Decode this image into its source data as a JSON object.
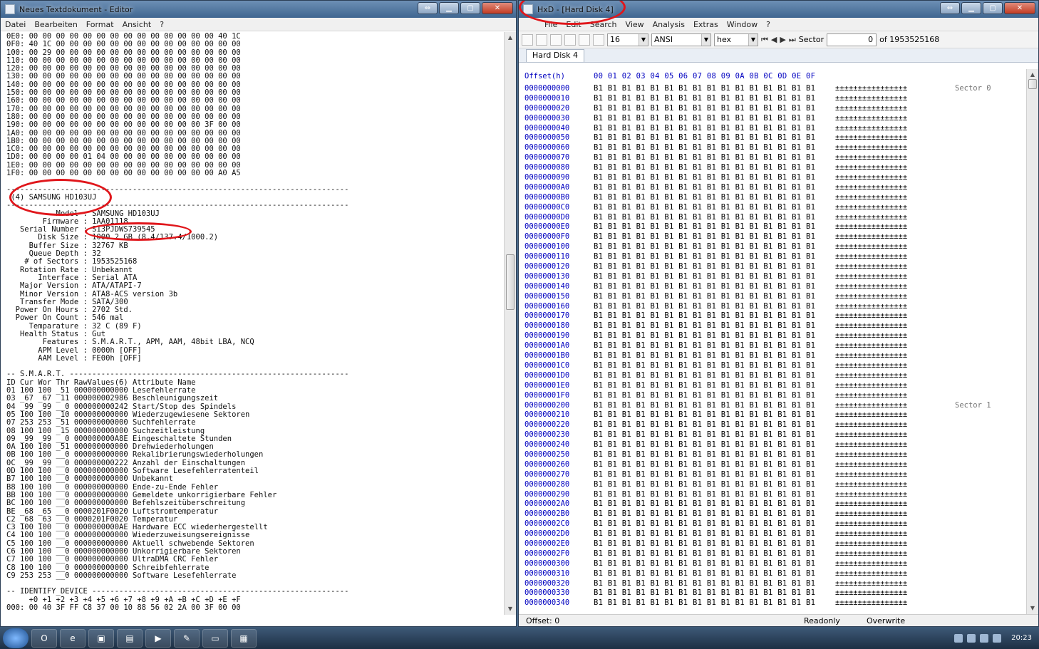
{
  "editor": {
    "title": "Neues Textdokument - Editor",
    "menu": [
      "Datei",
      "Bearbeiten",
      "Format",
      "Ansicht",
      "?"
    ],
    "lines": [
      "0E0: 00 00 00 00 00 00 00 00 00 00 00 00 00 00 40 1C",
      "0F0: 40 1C 00 00 00 00 00 00 00 00 00 00 00 00 00 00",
      "100: 00 29 00 00 00 00 00 00 00 00 00 00 00 00 00 00",
      "110: 00 00 00 00 00 00 00 00 00 00 00 00 00 00 00 00",
      "120: 00 00 00 00 00 00 00 00 00 00 00 00 00 00 00 00",
      "130: 00 00 00 00 00 00 00 00 00 00 00 00 00 00 00 00",
      "140: 00 00 00 00 00 00 00 00 00 00 00 00 00 00 00 00",
      "150: 00 00 00 00 00 00 00 00 00 00 00 00 00 00 00 00",
      "160: 00 00 00 00 00 00 00 00 00 00 00 00 00 00 00 00",
      "170: 00 00 00 00 00 00 00 00 00 00 00 00 00 00 00 00",
      "180: 00 00 00 00 00 00 00 00 00 00 00 00 00 00 00 00",
      "190: 00 00 00 00 00 00 00 00 00 00 00 00 00 3F 00 00",
      "1A0: 00 00 00 00 00 00 00 00 00 00 00 00 00 00 00 00",
      "1B0: 00 00 00 00 00 00 00 00 00 00 00 00 00 00 00 00",
      "1C0: 00 00 00 00 00 00 00 00 00 00 00 00 00 00 00 00",
      "1D0: 00 00 00 00 01 04 00 00 00 00 00 00 00 00 00 00",
      "1E0: 00 00 00 00 00 00 00 00 00 00 00 00 00 00 00 00",
      "1F0: 00 00 00 00 00 00 00 00 00 00 00 00 00 00 A0 A5",
      "",
      "----------------------------------------------------------------------------",
      " (4) SAMSUNG HD103UJ",
      "----------------------------------------------------------------------------",
      "           Model : SAMSUNG HD103UJ",
      "        Firmware : 1AA01118",
      "   Serial Number : S13PJDWS739545",
      "       Disk Size : 1000.2 GB (8.4/137.4/1000.2)",
      "     Buffer Size : 32767 KB",
      "     Queue Depth : 32",
      "    # of Sectors : 1953525168",
      "   Rotation Rate : Unbekannt",
      "       Interface : Serial ATA",
      "   Major Version : ATA/ATAPI-7",
      "   Minor Version : ATA8-ACS version 3b",
      "   Transfer Mode : SATA/300",
      "  Power On Hours : 2702 Std.",
      "  Power On Count : 546 mal",
      "     Temparature : 32 C (89 F)",
      "   Health Status : Gut",
      "        Features : S.M.A.R.T., APM, AAM, 48bit LBA, NCQ",
      "       APM Level : 0000h [OFF]",
      "       AAM Level : FE00h [OFF]",
      "",
      "-- S.M.A.R.T. --------------------------------------------------------------",
      "ID Cur Wor Thr RawValues(6) Attribute Name",
      "01 100 100 _51 000000000000 Lesefehlerrate",
      "03 _67 _67 _11 000000002986 Beschleunigungszeit",
      "04 _99 _99 __0 000000000242 Start/Stop des Spindels",
      "05 100 100 _10 000000000000 Wiederzugewiesene Sektoren",
      "07 253 253 _51 000000000000 Suchfehlerrate",
      "08 100 100 _15 000000000000 Suchzeitleistung",
      "09 _99 _99 __0 000000000A8E Eingeschaltete Stunden",
      "0A 100 100 _51 000000000000 Drehwiederholungen",
      "0B 100 100 __0 000000000000 Rekalibrierungswiederholungen",
      "0C _99 _99 __0 000000000222 Anzahl der Einschaltungen",
      "0D 100 100 __0 000000000000 Software Lesefehlerratenteil",
      "B7 100 100 __0 000000000000 Unbekannt",
      "B8 100 100 __0 000000000000 Ende-zu-Ende Fehler",
      "BB 100 100 __0 000000000000 Gemeldete unkorrigierbare Fehler",
      "BC 100 100 __0 000000000000 Befehlszeitüberschreitung",
      "BE _68 _65 __0 0000201F0020 Luftstromtemperatur",
      "C2 _68 _63 __0 0000201F0020 Temperatur",
      "C3 100 100 __0 0000000000AE Hardware ECC wiederhergestellt",
      "C4 100 100 __0 000000000000 Wiederzuweisungsereignisse",
      "C5 100 100 __0 000000000000 Aktuell schwebende Sektoren",
      "C6 100 100 __0 000000000000 Unkorrigierbare Sektoren",
      "C7 100 100 __0 000000000000 UltraDMA CRC Fehler",
      "C8 100 100 __0 000000000000 Schreibfehlerrate",
      "C9 253 253 __0 000000000000 Software Lesefehlerrate",
      "",
      "-- IDENTIFY_DEVICE ---------------------------------------------------------",
      "     +0 +1 +2 +3 +4 +5 +6 +7 +8 +9 +A +B +C +D +E +F",
      "000: 00 40 3F FF C8 37 00 10 88 56 02 2A 00 3F 00 00"
    ]
  },
  "hxd": {
    "title": "HxD - [Hard Disk 4]",
    "menu": [
      "File",
      "Edit",
      "Search",
      "View",
      "Analysis",
      "Extras",
      "Window",
      "?"
    ],
    "toolbar": {
      "bytes_per_row": "16",
      "charset": "ANSI",
      "display": "hex",
      "sector_label": "Sector",
      "sector_value": "0",
      "sector_total": "of 1953525168"
    },
    "tab": "Hard Disk 4",
    "header_offset": "Offset(h)",
    "header_cols": "00 01 02 03 04 05 06 07 08 09 0A 0B 0C 0D 0E 0F",
    "byte_row": "B1 B1 B1 B1 B1 B1 B1 B1 B1 B1 B1 B1 B1 B1 B1 B1",
    "ascii_row": "±±±±±±±±±±±±±±±±",
    "offsets": [
      "0000000000",
      "0000000010",
      "0000000020",
      "0000000030",
      "0000000040",
      "0000000050",
      "0000000060",
      "0000000070",
      "0000000080",
      "0000000090",
      "00000000A0",
      "00000000B0",
      "00000000C0",
      "00000000D0",
      "00000000E0",
      "00000000F0",
      "0000000100",
      "0000000110",
      "0000000120",
      "0000000130",
      "0000000140",
      "0000000150",
      "0000000160",
      "0000000170",
      "0000000180",
      "0000000190",
      "00000001A0",
      "00000001B0",
      "00000001C0",
      "00000001D0",
      "00000001E0",
      "00000001F0",
      "0000000200",
      "0000000210",
      "0000000220",
      "0000000230",
      "0000000240",
      "0000000250",
      "0000000260",
      "0000000270",
      "0000000280",
      "0000000290",
      "00000002A0",
      "00000002B0",
      "00000002C0",
      "00000002D0",
      "00000002E0",
      "00000002F0",
      "0000000300",
      "0000000310",
      "0000000320",
      "0000000330",
      "0000000340"
    ],
    "sector_labels": {
      "0": "Sector 0",
      "32": "Sector 1"
    },
    "status": {
      "offset": "Offset: 0",
      "mode": "Readonly",
      "write": "Overwrite"
    }
  },
  "taskbar": {
    "items": [
      "opera",
      "ie",
      "save",
      "folder",
      "media",
      "tool",
      "notepad",
      "hxd"
    ],
    "clock": "20:23"
  }
}
